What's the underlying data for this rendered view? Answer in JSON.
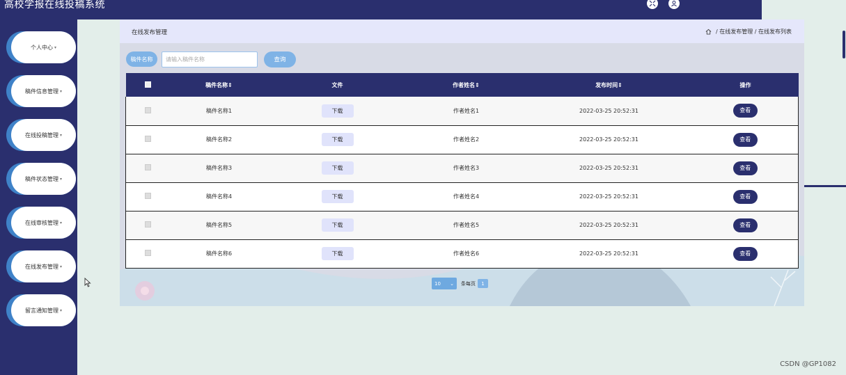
{
  "app": {
    "title": "高校学报在线投稿系统"
  },
  "sidebar": {
    "items": [
      {
        "label": "个人中心"
      },
      {
        "label": "稿件信息管理"
      },
      {
        "label": "在线投稿管理"
      },
      {
        "label": "稿件状态管理"
      },
      {
        "label": "在线审核管理"
      },
      {
        "label": "在线发布管理"
      },
      {
        "label": "留言通知管理"
      }
    ]
  },
  "page": {
    "title": "在线发布管理",
    "breadcrumb": [
      "在线发布管理",
      "在线发布列表"
    ]
  },
  "search": {
    "label": "稿件名称",
    "placeholder": "请输入稿件名称",
    "button": "查询"
  },
  "table": {
    "columns": [
      "稿件名称",
      "文件",
      "作者姓名",
      "发布时间",
      "操作"
    ],
    "rows": [
      {
        "name": "稿件名称1",
        "file": "下载",
        "author": "作者姓名1",
        "time": "2022-03-25 20:52:31",
        "action": "查看"
      },
      {
        "name": "稿件名称2",
        "file": "下载",
        "author": "作者姓名2",
        "time": "2022-03-25 20:52:31",
        "action": "查看"
      },
      {
        "name": "稿件名称3",
        "file": "下载",
        "author": "作者姓名3",
        "time": "2022-03-25 20:52:31",
        "action": "查看"
      },
      {
        "name": "稿件名称4",
        "file": "下载",
        "author": "作者姓名4",
        "time": "2022-03-25 20:52:31",
        "action": "查看"
      },
      {
        "name": "稿件名称5",
        "file": "下载",
        "author": "作者姓名5",
        "time": "2022-03-25 20:52:31",
        "action": "查看"
      },
      {
        "name": "稿件名称6",
        "file": "下载",
        "author": "作者姓名6",
        "time": "2022-03-25 20:52:31",
        "action": "查看"
      }
    ]
  },
  "pagination": {
    "page_size": "10",
    "page_size_label": "条每页",
    "current_page": "1"
  },
  "watermark": "CSDN @GP1082",
  "colors": {
    "primary": "#2a2f6e",
    "accent": "#7fb3e6",
    "background": "#e3eeea"
  }
}
